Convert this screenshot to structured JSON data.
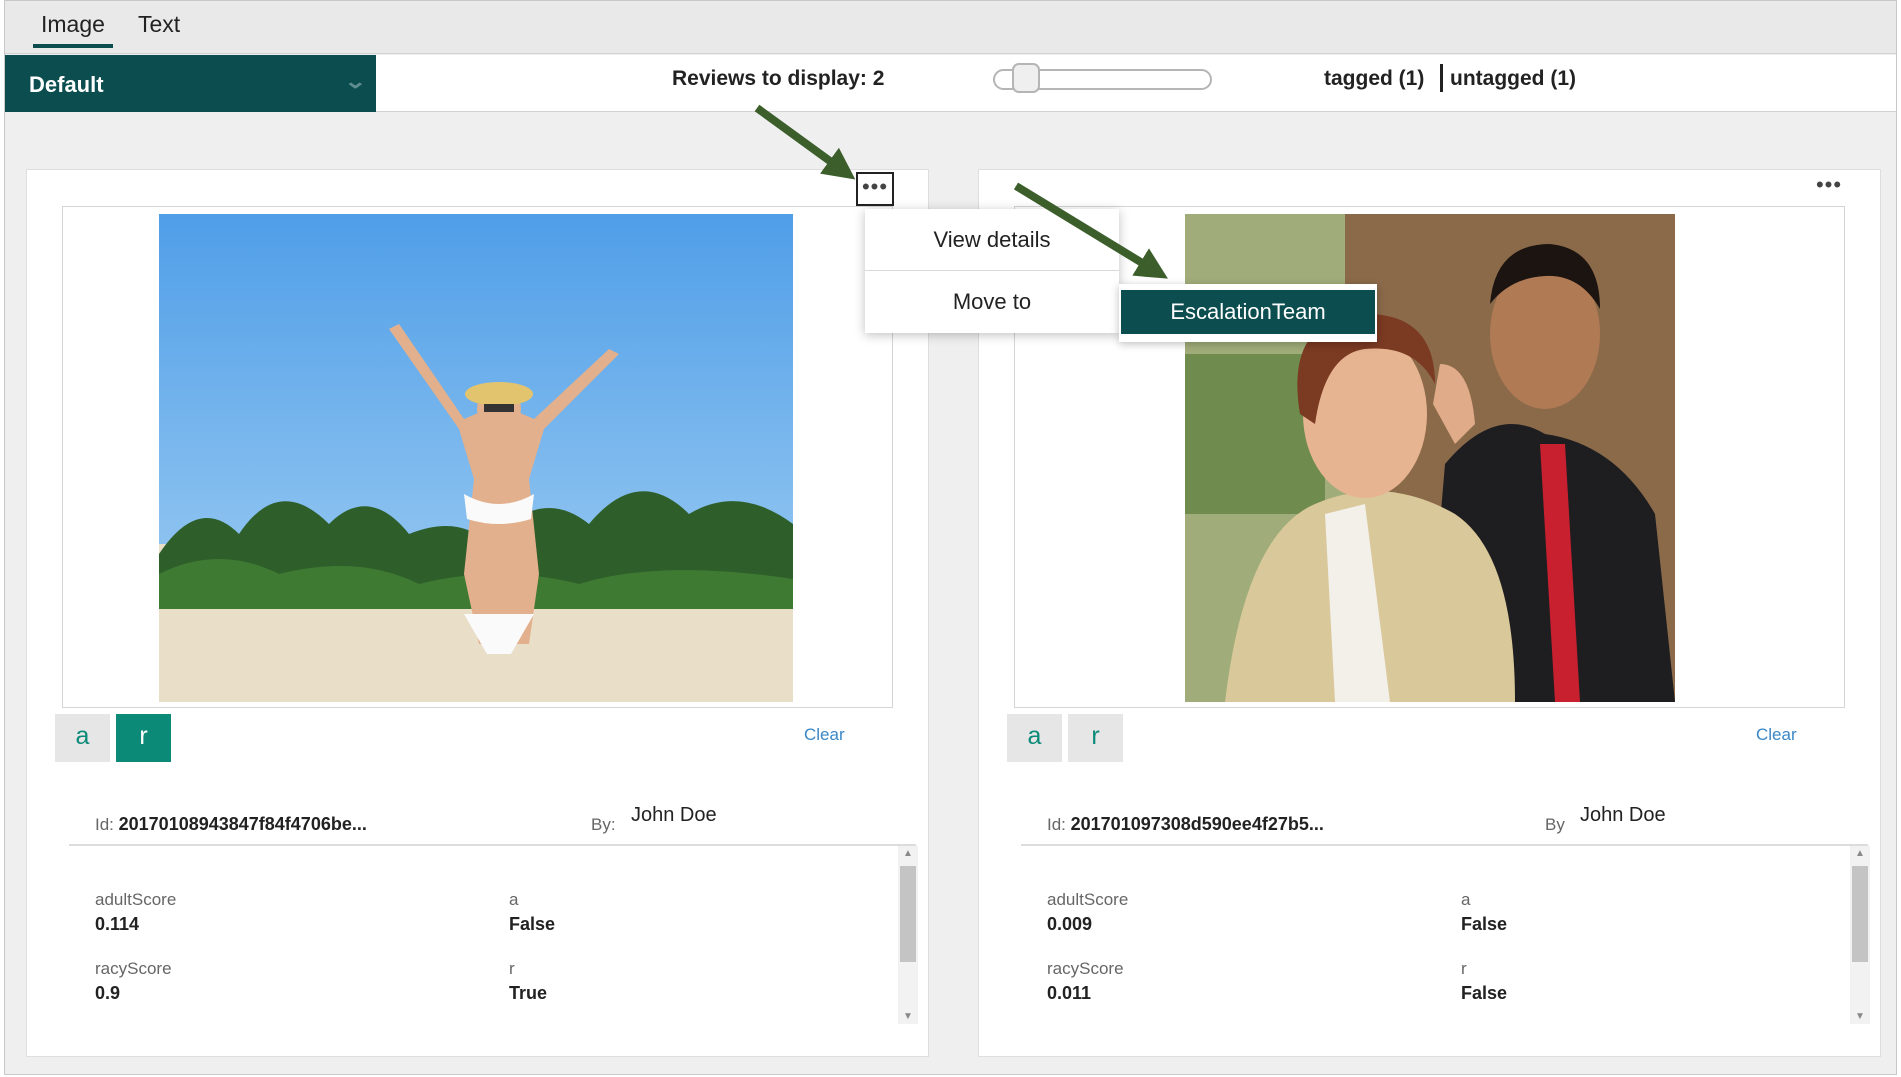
{
  "tabs": [
    {
      "label": "Image",
      "active": true
    },
    {
      "label": "Text",
      "active": false
    }
  ],
  "toolbar": {
    "queue": "Default",
    "reviews_label": "Reviews to display: 2",
    "reviews_value": 2,
    "tagged": "tagged (1)",
    "untagged": "untagged (1)"
  },
  "cards": [
    {
      "more": "•••",
      "image_description_icon": "beach-photo",
      "tags": [
        {
          "label": "a",
          "selected": false
        },
        {
          "label": "r",
          "selected": true
        }
      ],
      "clear": "Clear",
      "id_label": "Id:",
      "id": "20170108943847f84f4706be...",
      "by_label": "By:",
      "by": "John Doe",
      "fields": [
        {
          "label": "adultScore",
          "value": "0.114"
        },
        {
          "label": "a",
          "value": "False"
        },
        {
          "label": "racyScore",
          "value": "0.9"
        },
        {
          "label": "r",
          "value": "True"
        }
      ]
    },
    {
      "more": "•••",
      "image_description_icon": "people-photo",
      "tags": [
        {
          "label": "a",
          "selected": false
        },
        {
          "label": "r",
          "selected": false
        }
      ],
      "clear": "Clear",
      "id_label": "Id:",
      "id": "201701097308d590ee4f27b5...",
      "by_label": "By",
      "by": "John Doe",
      "fields": [
        {
          "label": "adultScore",
          "value": "0.009"
        },
        {
          "label": "a",
          "value": "False"
        },
        {
          "label": "racyScore",
          "value": "0.011"
        },
        {
          "label": "r",
          "value": "False"
        }
      ]
    }
  ],
  "menu": {
    "items": [
      "View details",
      "Move to"
    ],
    "submenu": [
      "EscalationTeam"
    ]
  },
  "colors": {
    "brand": "#0c4d4f",
    "tag_selected": "#0b8a78",
    "link": "#3b87c7",
    "annotation_arrow": "#3b5e2b"
  }
}
